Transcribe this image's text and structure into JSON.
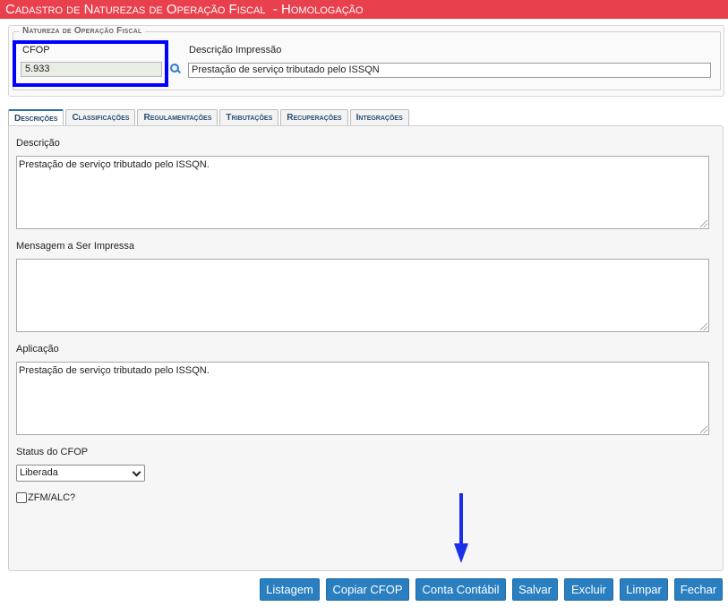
{
  "window": {
    "title": "Cadastro de Naturezas de Operação Fiscal",
    "environment": "- Homologação"
  },
  "natureza": {
    "legend": "Natureza de Operação Fiscal",
    "cfop_label": "CFOP",
    "cfop_value": "5.933",
    "desc_impressao_label": "Descrição Impressão",
    "desc_impressao_value": "Prestação de serviço tributado pelo ISSQN"
  },
  "tabs": [
    {
      "label": "Descrições",
      "active": true
    },
    {
      "label": "Classificações",
      "active": false
    },
    {
      "label": "Regulamentações",
      "active": false
    },
    {
      "label": "Tributações",
      "active": false
    },
    {
      "label": "Recuperações",
      "active": false
    },
    {
      "label": "Integrações",
      "active": false
    }
  ],
  "form": {
    "descricao_label": "Descrição",
    "descricao_value": "Prestação de serviço tributado pelo ISSQN.",
    "mensagem_label": "Mensagem a Ser Impressa",
    "mensagem_value": "",
    "aplicacao_label": "Aplicação",
    "aplicacao_value": "Prestação de serviço tributado pelo ISSQN.",
    "status_label": "Status do CFOP",
    "status_value": "Liberada",
    "zfm_label": "ZFM/ALC?",
    "zfm_checked": false
  },
  "buttons": {
    "listagem": "Listagem",
    "copiar": "Copiar CFOP",
    "conta": "Conta Contábil",
    "salvar": "Salvar",
    "excluir": "Excluir",
    "limpar": "Limpar",
    "fechar": "Fechar"
  },
  "colors": {
    "title_bar": "#e8404d",
    "button": "#2a7fc1",
    "highlight": "#0000ff",
    "arrow": "#1a2fe8"
  }
}
